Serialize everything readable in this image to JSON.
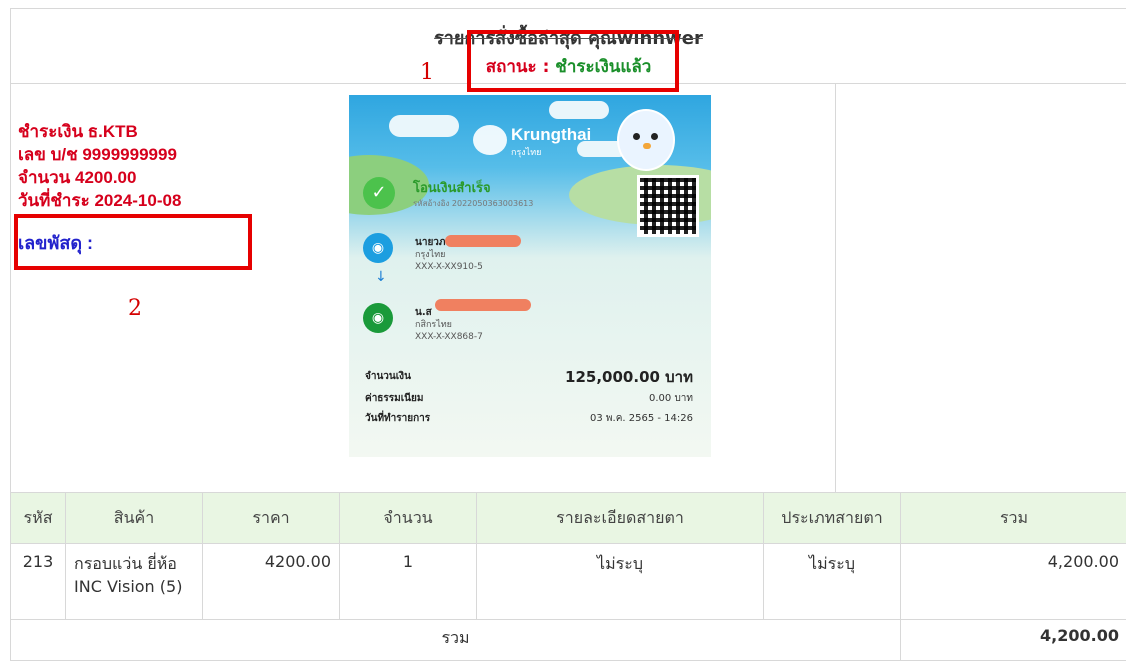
{
  "header": {
    "title": "รายการสั่งซื้อล่าสุด คุณwinnwer",
    "status_label": "สถานะ : ",
    "status_value": "ชำระเงินแล้ว"
  },
  "annotations": {
    "box1": "1",
    "box2": "2"
  },
  "payment": {
    "bank": "ชำระเงิน ธ.KTB",
    "account": "เลข บ/ช 9999999999",
    "amount": "จำนวน 4200.00",
    "date": "วันที่ชำระ 2024-10-08",
    "tracking_label": "เลขพัสดุ :"
  },
  "slip": {
    "brand": "Krungthai",
    "brand_th": "กรุงไทย",
    "status": "โอนเงินสำเร็จ",
    "ref": "รหัสอ้างอิง 2022050363003613",
    "sender_name": "นายวภ",
    "sender_bank": "กรุงไทย",
    "sender_acct": "XXX-X-XX910-5",
    "receiver_name": "น.ส",
    "receiver_bank": "กสิกรไทย",
    "receiver_acct": "XXX-X-XX868-7",
    "amount_label": "จำนวนเงิน",
    "amount_value": "125,000.00 บาท",
    "fee_label": "ค่าธรรมเนียม",
    "fee_value": "0.00 บาท",
    "date_label": "วันที่ทำรายการ",
    "date_value": "03 พ.ค. 2565 - 14:26"
  },
  "table": {
    "headers": [
      "รหัส",
      "สินค้า",
      "ราคา",
      "จำนวน",
      "รายละเอียดสายตา",
      "ประเภทสายตา",
      "รวม"
    ],
    "rows": [
      {
        "code": "213",
        "product": "กรอบแว่น ยี่ห้อ INC Vision (5)",
        "price": "4200.00",
        "qty": "1",
        "eye_detail": "ไม่ระบุ",
        "eye_type": "ไม่ระบุ",
        "total": "4,200.00"
      }
    ],
    "sum_label": "รวม",
    "sum_value": "4,200.00"
  },
  "colors": {
    "status_label": "#d6001c",
    "status_value": "#1a8f2a",
    "payment_text": "#d6001c",
    "tracking": "#2222cc",
    "annotation_box": "#e60000",
    "table_header_bg": "#e9f6e3"
  }
}
